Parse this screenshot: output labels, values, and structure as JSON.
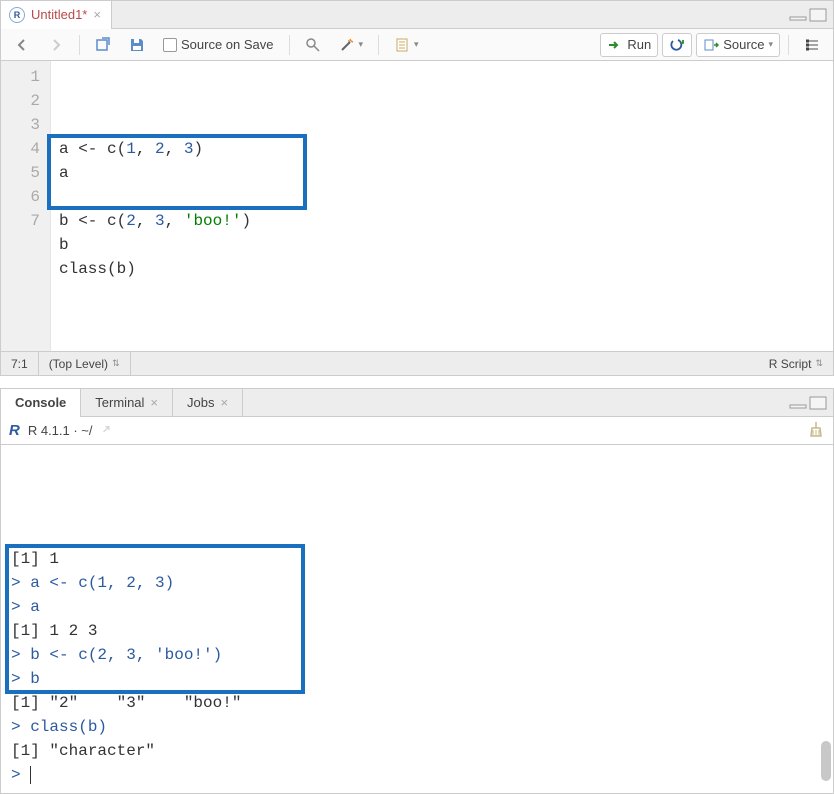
{
  "editor_pane": {
    "tab": {
      "title": "Untitled1*",
      "icon_letter": "R"
    },
    "toolbar": {
      "source_on_save": "Source on Save",
      "run": "Run",
      "source": "Source"
    },
    "code_lines": [
      {
        "n": 1,
        "tokens": [
          {
            "t": "a <- c(",
            "c": "kw"
          },
          {
            "t": "1",
            "c": "num"
          },
          {
            "t": ", ",
            "c": "kw"
          },
          {
            "t": "2",
            "c": "num"
          },
          {
            "t": ", ",
            "c": "kw"
          },
          {
            "t": "3",
            "c": "num"
          },
          {
            "t": ")",
            "c": "kw"
          }
        ]
      },
      {
        "n": 2,
        "tokens": [
          {
            "t": "a",
            "c": "kw"
          }
        ]
      },
      {
        "n": 3,
        "tokens": []
      },
      {
        "n": 4,
        "tokens": [
          {
            "t": "b <- c(",
            "c": "kw"
          },
          {
            "t": "2",
            "c": "num"
          },
          {
            "t": ", ",
            "c": "kw"
          },
          {
            "t": "3",
            "c": "num"
          },
          {
            "t": ", ",
            "c": "kw"
          },
          {
            "t": "'boo!'",
            "c": "str"
          },
          {
            "t": ")",
            "c": "kw"
          }
        ]
      },
      {
        "n": 5,
        "tokens": [
          {
            "t": "b",
            "c": "kw"
          }
        ]
      },
      {
        "n": 6,
        "tokens": [
          {
            "t": "class(b)",
            "c": "kw"
          }
        ]
      },
      {
        "n": 7,
        "tokens": []
      }
    ],
    "status": {
      "pos": "7:1",
      "scope": "(Top Level)",
      "type": "R Script"
    }
  },
  "console_pane": {
    "tabs": [
      {
        "label": "Console",
        "active": true,
        "closeable": false
      },
      {
        "label": "Terminal",
        "active": false,
        "closeable": true
      },
      {
        "label": "Jobs",
        "active": false,
        "closeable": true
      }
    ],
    "header": "R 4.1.1 · ~/",
    "lines": [
      {
        "type": "output",
        "text": "[1] 1"
      },
      {
        "type": "input",
        "text": "> a <- c(1, 2, 3)"
      },
      {
        "type": "input",
        "text": "> a"
      },
      {
        "type": "output",
        "text": "[1] 1 2 3"
      },
      {
        "type": "input",
        "text": "> b <- c(2, 3, 'boo!')"
      },
      {
        "type": "input",
        "text": "> b"
      },
      {
        "type": "output",
        "text": "[1] \"2\"    \"3\"    \"boo!\""
      },
      {
        "type": "input",
        "text": "> class(b)"
      },
      {
        "type": "output",
        "text": "[1] \"character\""
      },
      {
        "type": "prompt",
        "text": "> "
      }
    ]
  }
}
